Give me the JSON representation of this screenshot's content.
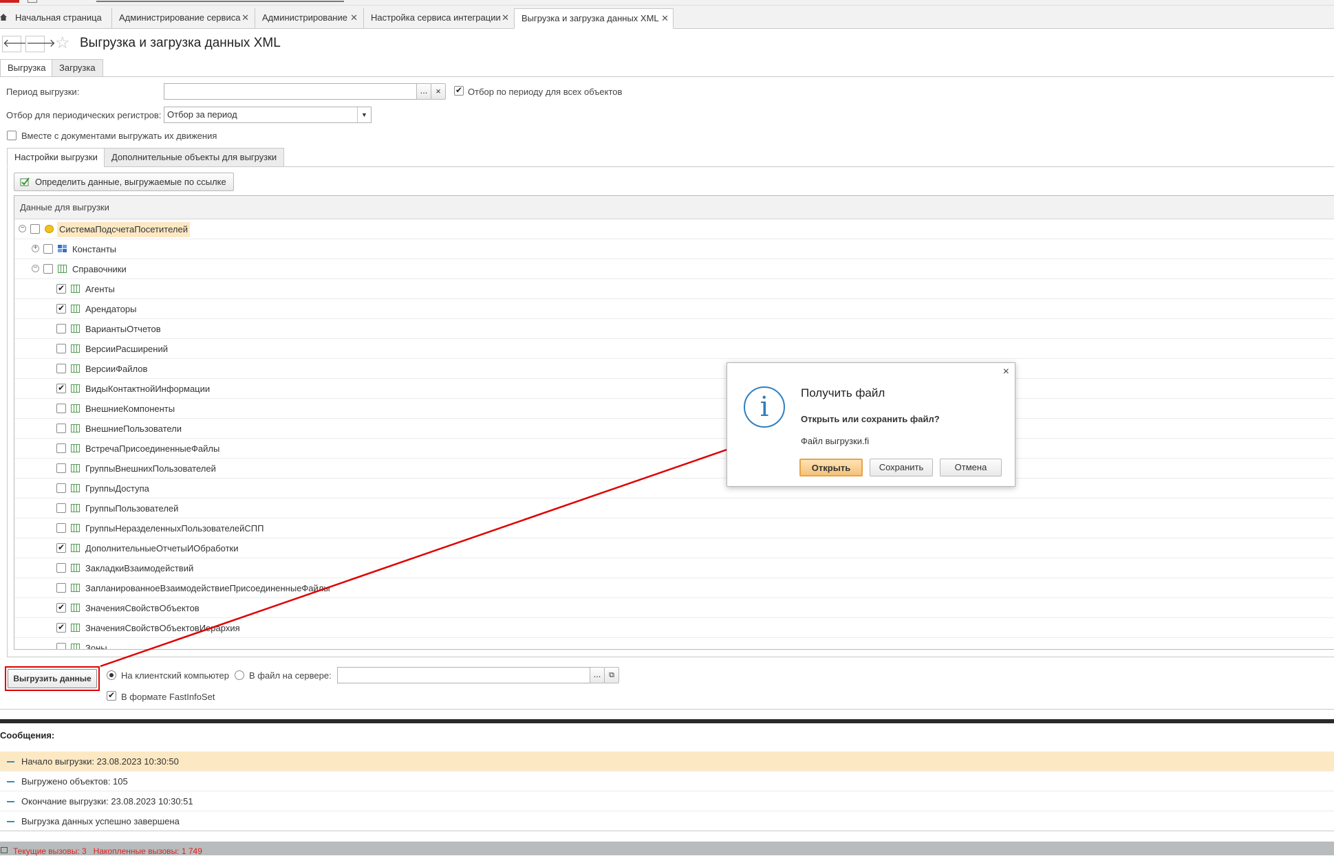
{
  "window_tabs": [
    {
      "label": "Начальная страница"
    },
    {
      "label": "Администрирование сервиса"
    },
    {
      "label": "Администрирование"
    },
    {
      "label": "Настройка сервиса интеграции"
    },
    {
      "label": "Выгрузка и загрузка данных XML"
    }
  ],
  "page_title": "Выгрузка и загрузка данных XML",
  "mode_tabs": [
    "Выгрузка",
    "Загрузка"
  ],
  "form": {
    "period_label": "Период выгрузки:",
    "period_value": "",
    "period_ellipsis": "...",
    "period_clear": "×",
    "filter_all_label": "Отбор по периоду для всех объектов",
    "filter_all_checked": true,
    "periodic_label": "Отбор для периодических регистров:",
    "periodic_value": "Отбор за период",
    "with_movements_label": "Вместе с документами выгружать их движения",
    "with_movements_checked": false
  },
  "inner_tabs": [
    "Настройки выгрузки",
    "Дополнительные объекты для выгрузки"
  ],
  "define_button": "Определить данные, выгружаемые по ссылке",
  "tree": {
    "header": "Данные для выгрузки",
    "rows": [
      {
        "label": "СистемаПодсчетаПосетителей",
        "checked": false
      },
      {
        "label": "Константы",
        "checked": false
      },
      {
        "label": "Справочники",
        "checked": false
      },
      {
        "label": "Агенты",
        "checked": true
      },
      {
        "label": "Арендаторы",
        "checked": true
      },
      {
        "label": "ВариантыОтчетов",
        "checked": false
      },
      {
        "label": "ВерсииРасширений",
        "checked": false
      },
      {
        "label": "ВерсииФайлов",
        "checked": false
      },
      {
        "label": "ВидыКонтактнойИнформации",
        "checked": true
      },
      {
        "label": "ВнешниеКомпоненты",
        "checked": false
      },
      {
        "label": "ВнешниеПользователи",
        "checked": false
      },
      {
        "label": "ВстречаПрисоединенныеФайлы",
        "checked": false
      },
      {
        "label": "ГруппыВнешнихПользователей",
        "checked": false
      },
      {
        "label": "ГруппыДоступа",
        "checked": false
      },
      {
        "label": "ГруппыПользователей",
        "checked": false
      },
      {
        "label": "ГруппыНеразделенныхПользователейСПП",
        "checked": false
      },
      {
        "label": "ДополнительныеОтчетыИОбработки",
        "checked": true
      },
      {
        "label": "ЗакладкиВзаимодействий",
        "checked": false
      },
      {
        "label": "ЗапланированноеВзаимодействиеПрисоединенныеФайлы",
        "checked": false
      },
      {
        "label": "ЗначенияСвойствОбъектов",
        "checked": true
      },
      {
        "label": "ЗначенияСвойствОбъектовИерархия",
        "checked": true
      },
      {
        "label": "Зоны",
        "checked": false
      }
    ]
  },
  "export": {
    "button": "Выгрузить данные",
    "client_label": "На клиентский компьютер",
    "server_label": "В файл на сервере:",
    "server_path": "",
    "ellipsis": "...",
    "fastinfoset_label": "В формате FastInfoSet",
    "fastinfoset_checked": true
  },
  "messages": {
    "title": "Сообщения:",
    "items": [
      "Начало выгрузки: 23.08.2023 10:30:50",
      "Выгружено объектов: 105",
      "Окончание выгрузки: 23.08.2023 10:30:51",
      "Выгрузка данных успешно завершена"
    ]
  },
  "status_text": "Текущие вызовы: 3   Накопленные вызовы: 1 749",
  "dialog": {
    "title": "Получить файл",
    "question": "Открыть или сохранить файл?",
    "filename": "Файл выгрузки.fi",
    "open": "Открыть",
    "save": "Сохранить",
    "cancel": "Отмена",
    "close": "×"
  },
  "colors": {
    "highlight": "#fce9c4",
    "annotation_red": "#e00000",
    "accent_blue": "#2f7fbf",
    "status_red": "#e02020"
  }
}
